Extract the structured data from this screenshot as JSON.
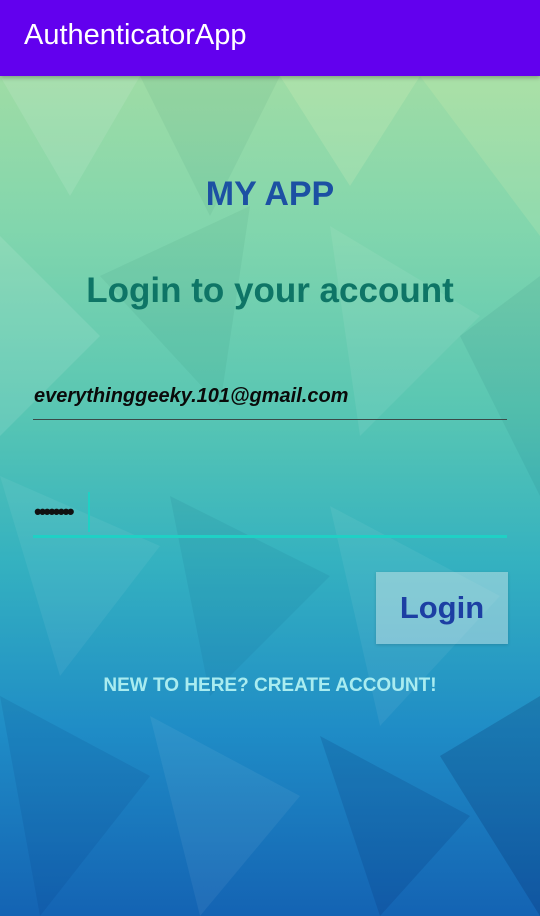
{
  "app_bar": {
    "title": "AuthenticatorApp"
  },
  "colors": {
    "app_bar": "#6200ee",
    "title_text": "#1c50a3",
    "heading_text": "#0e7566",
    "accent": "#1fd1c5",
    "button_text": "#1c3fa3"
  },
  "main": {
    "app_name": "MY APP",
    "heading": "Login to your account",
    "email_value": "everythinggeeky.101@gmail.com",
    "password_masked": "••••••••",
    "login_label": "Login",
    "create_account_link": "NEW TO HERE? CREATE ACCOUNT!"
  }
}
